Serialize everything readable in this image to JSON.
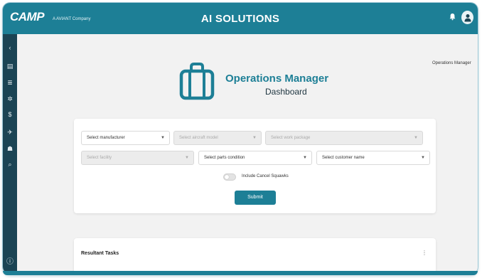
{
  "header": {
    "logo_text": "CAMP",
    "logo_sub": "A AVIANT Company",
    "app_title": "AI SOLUTIONS",
    "bell_icon": "bell-icon",
    "user_icon": "user-avatar-icon"
  },
  "sidebar": {
    "items": [
      {
        "icon": "collapse-icon",
        "glyph": "‹"
      },
      {
        "icon": "dashboard-icon",
        "glyph": "▤"
      },
      {
        "icon": "list-icon",
        "glyph": "≣"
      },
      {
        "icon": "settings-icon",
        "glyph": "✲"
      },
      {
        "icon": "dollar-icon",
        "glyph": "$"
      },
      {
        "icon": "aircraft-icon",
        "glyph": "✈"
      },
      {
        "icon": "person-icon",
        "glyph": "☗"
      },
      {
        "icon": "search-icon",
        "glyph": "⌕"
      }
    ],
    "bottom_icon": {
      "icon": "info-icon",
      "glyph": "ⓘ"
    }
  },
  "main": {
    "role_label": "Operations Manager",
    "dashboard_title": "Operations Manager",
    "dashboard_subtitle": "Dashboard",
    "briefcase_icon": "briefcase-icon"
  },
  "filters": {
    "manufacturer": {
      "placeholder": "Select manufacturer",
      "disabled": false
    },
    "aircraft_model": {
      "placeholder": "Select aircraft model",
      "disabled": true
    },
    "work_package": {
      "placeholder": "Select work package",
      "disabled": true
    },
    "facility": {
      "placeholder": "Select facility",
      "disabled": true
    },
    "parts_condition": {
      "placeholder": "Select parts condition",
      "disabled": false
    },
    "customer_name": {
      "placeholder": "Select customer name",
      "disabled": false
    },
    "include_label": "Include Cancel Squawks",
    "include_checked": false,
    "submit_label": "Submit"
  },
  "results": {
    "title": "Resultant Tasks"
  },
  "colors": {
    "accent": "#1d7f96",
    "sidebar": "#1b4454",
    "background": "#f2f2f2"
  }
}
